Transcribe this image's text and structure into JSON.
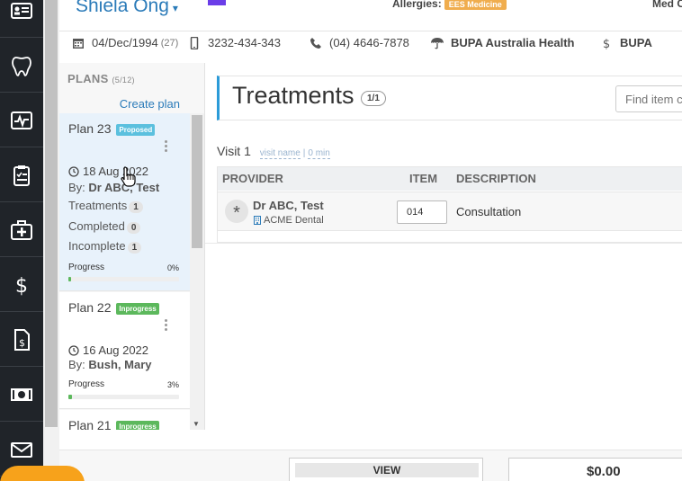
{
  "patient": {
    "name": "Shiela Ong",
    "allergies_label": "Allergies:",
    "allergy_badge": "EES Medicine",
    "med_label": "Med C"
  },
  "info_bar": {
    "dob": "04/Dec/1994",
    "age": "(27)",
    "mobile": "3232-434-343",
    "phone": "(04) 4646-7878",
    "insurer": "BUPA Australia Health",
    "billing": "BUPA"
  },
  "plans_panel": {
    "title": "PLANS",
    "count": "(5/12)",
    "create_label": "Create plan",
    "plans": [
      {
        "title": "Plan 23",
        "status": "Proposed",
        "date": "18 Aug 2022",
        "by_label": "By:",
        "by": "Dr ABC, Test",
        "treatments_label": "Treatments",
        "treatments": "1",
        "completed_label": "Completed",
        "completed": "0",
        "incomplete_label": "Incomplete",
        "incomplete": "1",
        "progress_label": "Progress",
        "progress_text": "0%",
        "progress": 0
      },
      {
        "title": "Plan 22",
        "status": "Inprogress",
        "date": "16 Aug 2022",
        "by_label": "By:",
        "by": "Bush, Mary",
        "progress_label": "Progress",
        "progress_text": "3%",
        "progress": 3
      },
      {
        "title": "Plan 21",
        "status": "Inprogress"
      }
    ]
  },
  "treatments": {
    "title": "Treatments",
    "count": "1/1",
    "search_placeholder": "Find item c",
    "visit_label": "Visit 1",
    "visit_name": "visit name",
    "visit_sep": "|",
    "visit_duration": "0 min",
    "columns": [
      "PROVIDER",
      "ITEM",
      "DESCRIPTION"
    ],
    "rows": [
      {
        "provider": "Dr ABC, Test",
        "clinic": "ACME Dental",
        "item": "014",
        "description": "Consultation"
      }
    ]
  },
  "footer": {
    "view_label": "VIEW",
    "total": "$0.00"
  },
  "colors": {
    "nav_bg": "#202429",
    "accent_blue": "#2b7bb9",
    "proposed": "#5bc0de",
    "inprogress": "#5cb85c",
    "allergy": "#f0ad4e",
    "help": "#f7a21b"
  },
  "nav_icons": [
    "id-card-icon",
    "tooth-icon",
    "pulse-icon",
    "clipboard-icon",
    "medical-kit-icon",
    "dollar-icon",
    "invoice-icon",
    "cash-icon",
    "mail-icon"
  ]
}
